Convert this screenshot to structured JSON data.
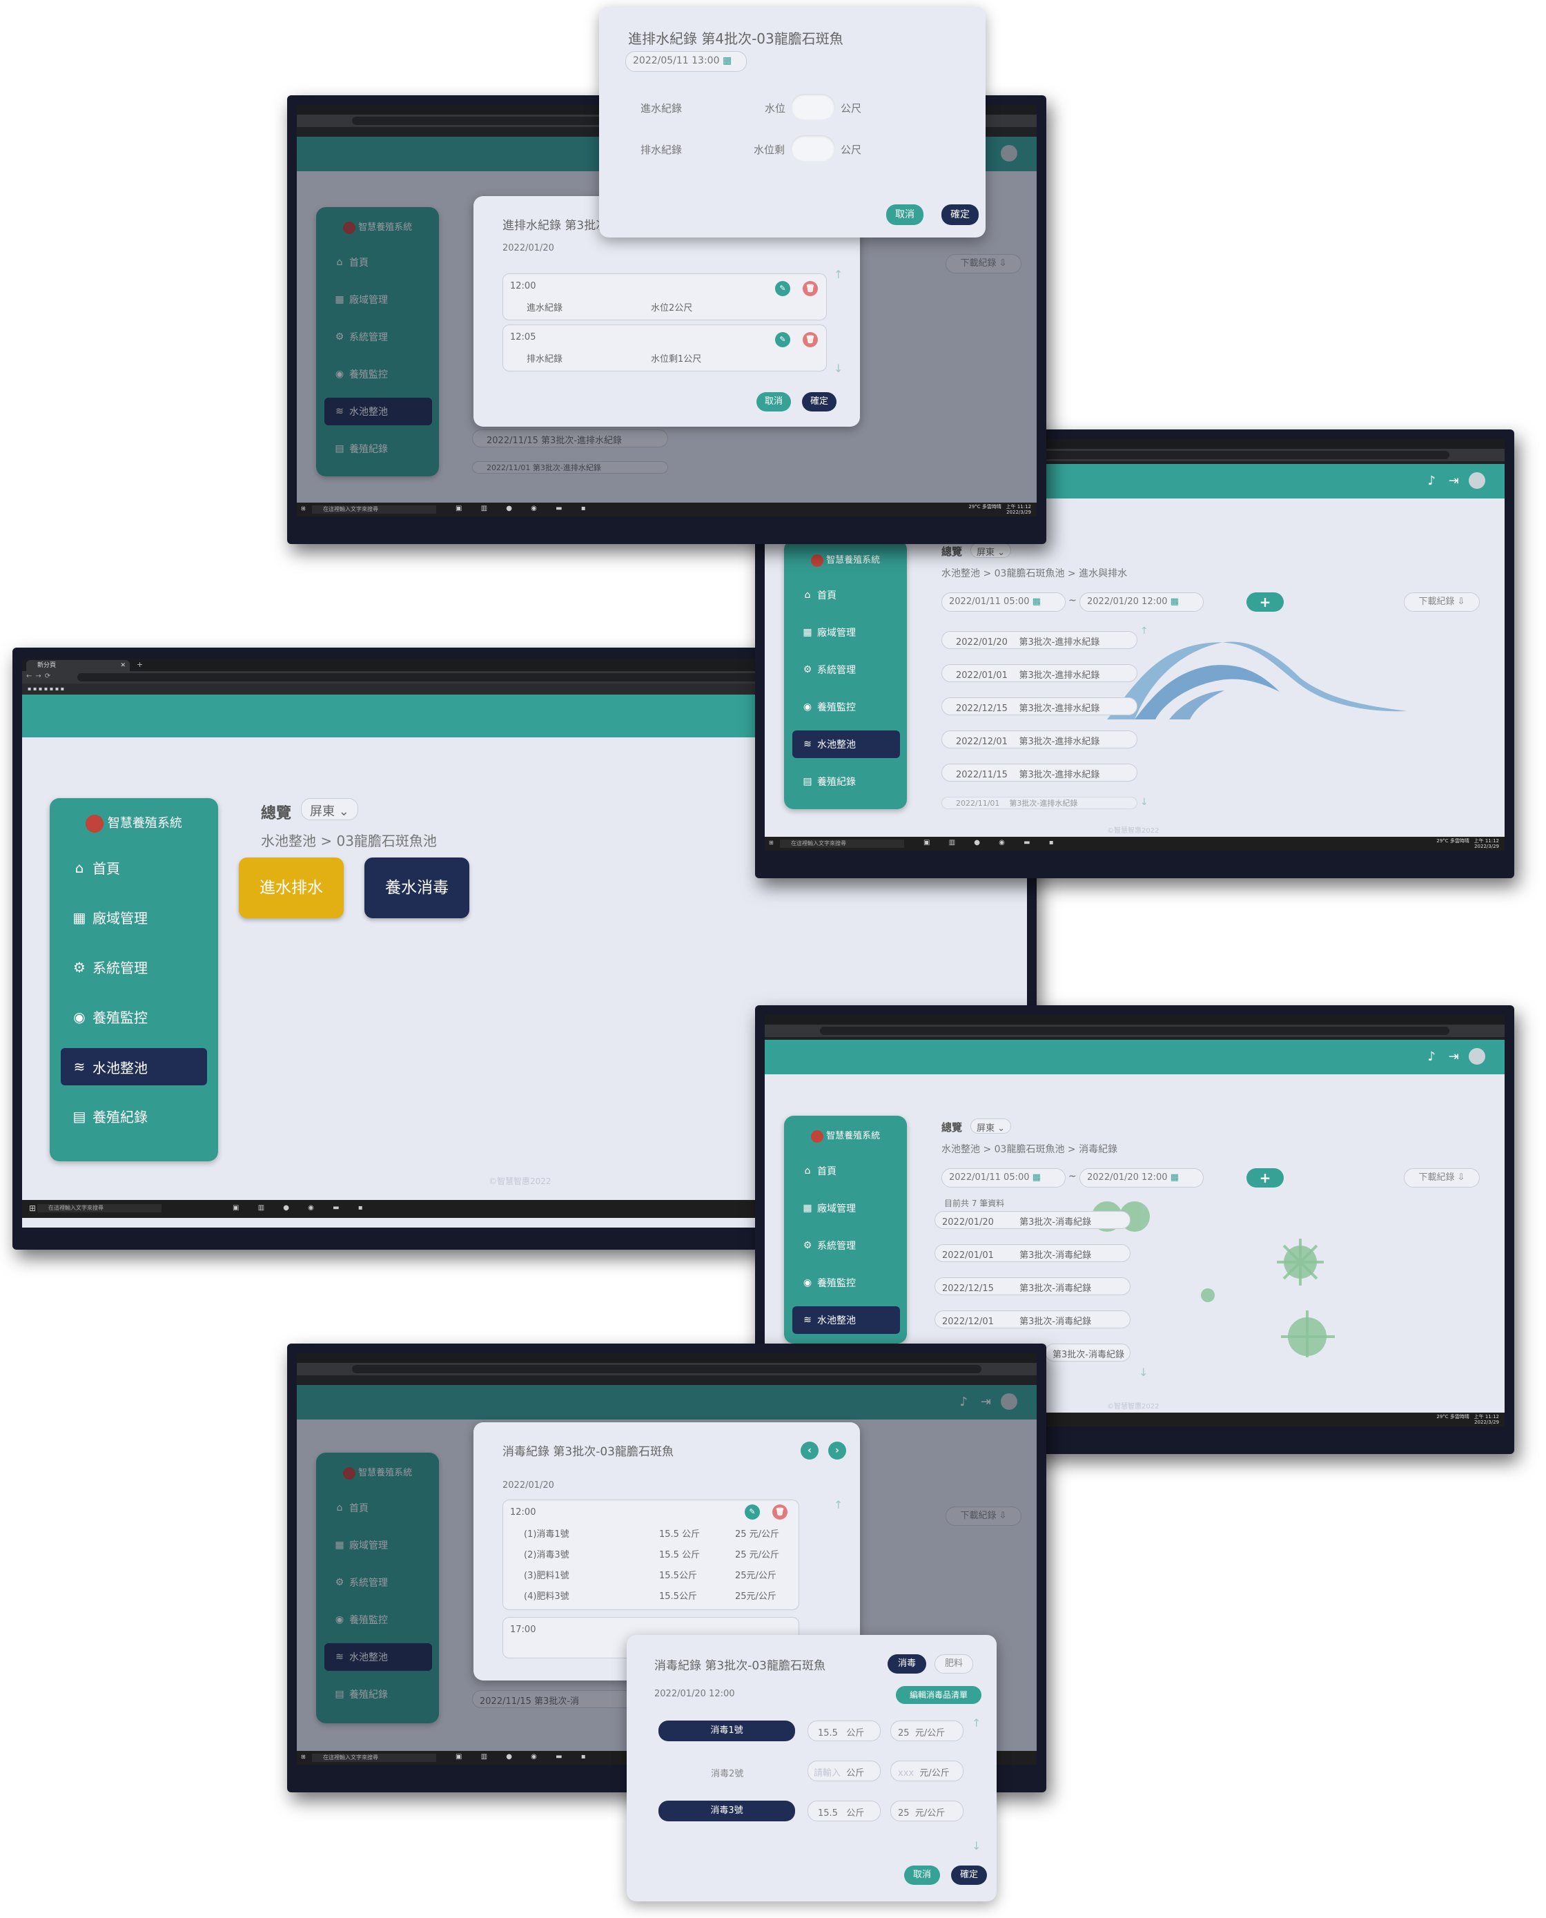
{
  "common": {
    "brand": "智慧養殖系統",
    "menu": [
      "首頁",
      "廠域管理",
      "系統管理",
      "養殖監控",
      "水池整池",
      "養殖紀錄"
    ],
    "menu_icons": [
      "home-icon",
      "warehouse-icon",
      "gears-icon",
      "eye-icon",
      "water-icon",
      "clipboard-icon"
    ],
    "overview": "總覽",
    "region": "屏東",
    "download": "下載紀錄",
    "footer": "©智慧智惠2022",
    "cancel": "取消",
    "confirm": "確定",
    "taskbar_search": "在這裡輸入文字來搜尋",
    "tab_title": "新分頁",
    "weather": "29°C 多雲時晴",
    "clock_time": "上午 11:12",
    "clock_date": "2022/3/29"
  },
  "screen_main": {
    "breadcrumb": "水池整池 > 03龍膽石斑魚池",
    "btn_in_out": "進水排水",
    "btn_disinfect": "養水消毒"
  },
  "screen_inout_list": {
    "breadcrumb": "水池整池 > 03龍膽石斑魚池 > 進水與排水",
    "date_from": "2022/01/11  05:00",
    "tilde": "~",
    "date_to": "2022/01/20  12:00",
    "records": [
      {
        "date": "2022/01/20",
        "title": "第3批次-進排水紀錄"
      },
      {
        "date": "2022/01/01",
        "title": "第3批次-進排水紀錄"
      },
      {
        "date": "2022/12/15",
        "title": "第3批次-進排水紀錄"
      },
      {
        "date": "2022/12/01",
        "title": "第3批次-進排水紀錄"
      },
      {
        "date": "2022/11/15",
        "title": "第3批次-進排水紀錄"
      },
      {
        "date": "2022/11/01",
        "title": "第3批次-進排水紀錄"
      }
    ]
  },
  "screen_inout_detail": {
    "title": "進排水紀錄 第3批次-03龍膽石斑魚",
    "date": "2022/01/20",
    "entries": [
      {
        "time": "12:00",
        "type": "進水紀錄",
        "value": "水位2公尺"
      },
      {
        "time": "12:05",
        "type": "排水紀錄",
        "value": "水位剩1公尺"
      }
    ],
    "bg_records": [
      "2022/11/15      第3批次-進排水紀錄",
      "2022/11/01      第3批次-進排水紀錄"
    ]
  },
  "top_modal": {
    "title": "進排水紀錄 第4批次-03龍膽石斑魚",
    "datetime": "2022/05/11  13:00",
    "rows": [
      {
        "label": "進水紀錄",
        "field": "水位",
        "unit": "公尺"
      },
      {
        "label": "排水紀錄",
        "field": "水位剩",
        "unit": "公尺"
      }
    ]
  },
  "screen_disinfect_list": {
    "breadcrumb": "水池整池 > 03龍膽石斑魚池 > 消毒紀錄",
    "count": "目前共 7 筆資料",
    "date_from": "2022/01/11  05:00",
    "date_to": "2022/01/20  12:00",
    "records": [
      {
        "date": "2022/01/20",
        "title": "第3批次-消毒紀錄"
      },
      {
        "date": "2022/01/01",
        "title": "第3批次-消毒紀錄"
      },
      {
        "date": "2022/12/15",
        "title": "第3批次-消毒紀錄"
      },
      {
        "date": "2022/12/01",
        "title": "第3批次-消毒紀錄"
      },
      {
        "date": "",
        "title": "第3批次-消毒紀錄"
      }
    ]
  },
  "screen_disinfect_detail": {
    "title": "消毒紀錄 第3批次-03龍膽石斑魚",
    "date": "2022/01/20",
    "time1": "12:00",
    "items": [
      {
        "name": "(1)消毒1號",
        "qty": "15.5 公斤",
        "price": "25 元/公斤"
      },
      {
        "name": "(2)消毒3號",
        "qty": "15.5 公斤",
        "price": "25 元/公斤"
      },
      {
        "name": "(3)肥料1號",
        "qty": "15.5公斤",
        "price": "25元/公斤"
      },
      {
        "name": "(4)肥料3號",
        "qty": "15.5公斤",
        "price": "25元/公斤"
      }
    ],
    "time2": "17:00",
    "bg_record": "2022/11/15          第3批次-消"
  },
  "bottom_modal": {
    "title": "消毒紀錄 第3批次-03龍膽石斑魚",
    "tab_disinfect": "消毒",
    "tab_fertilizer": "肥料",
    "datetime": "2022/01/20  12:00",
    "edit_list": "編輯消毒品清單",
    "rows": [
      {
        "name": "消毒1號",
        "active": true,
        "qty": "15.5",
        "qty_unit": "公斤",
        "price": "25",
        "price_unit": "元/公斤"
      },
      {
        "name": "消毒2號",
        "active": false,
        "qty": "請輸入",
        "qty_unit": "公斤",
        "price": "xxx",
        "price_unit": "元/公斤"
      },
      {
        "name": "消毒3號",
        "active": true,
        "qty": "15.5",
        "qty_unit": "公斤",
        "price": "25",
        "price_unit": "元/公斤"
      }
    ]
  }
}
